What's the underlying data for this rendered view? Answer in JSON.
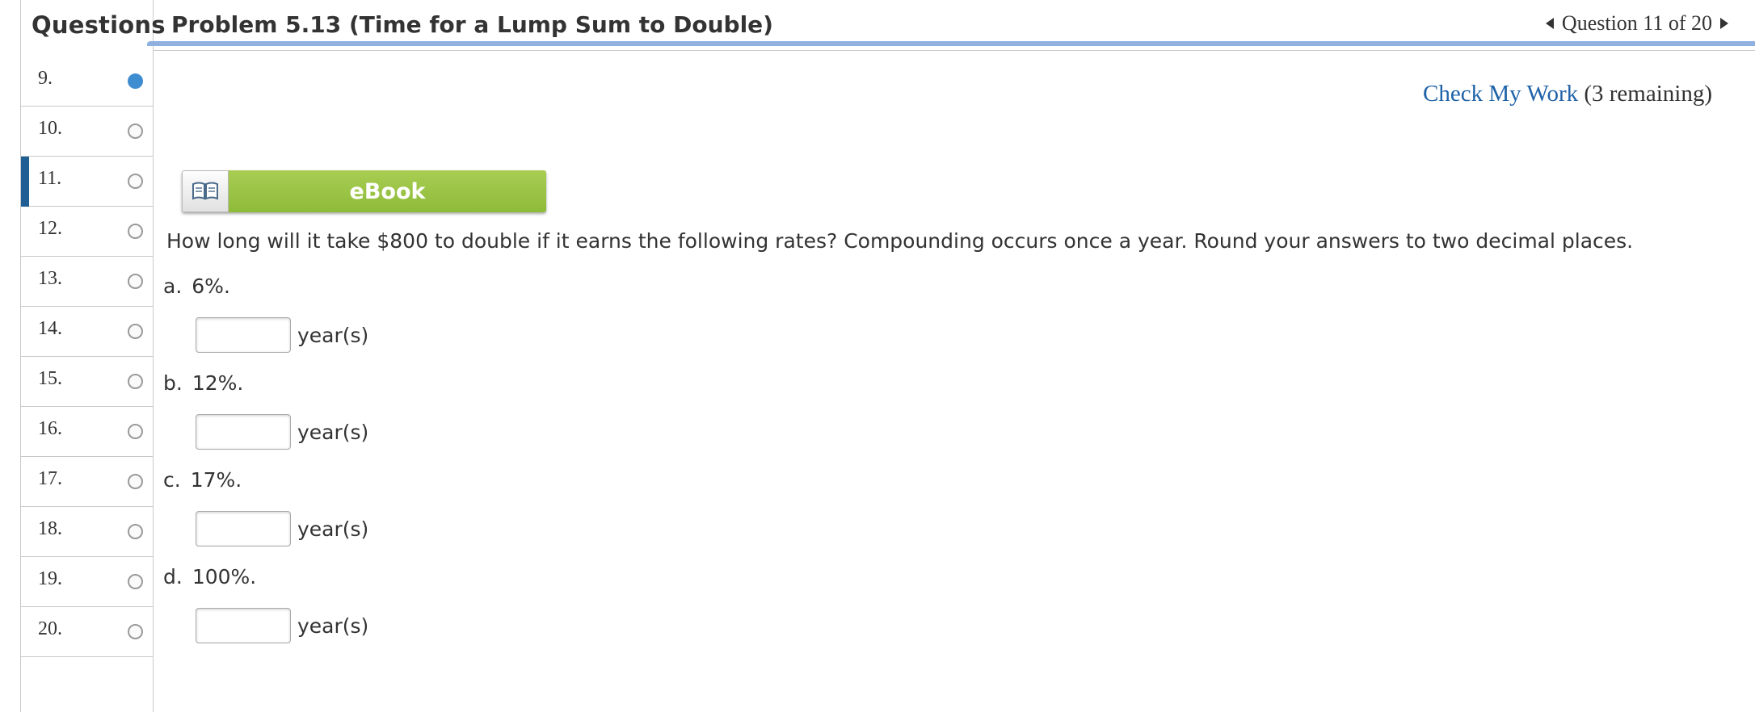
{
  "sidebar": {
    "title": "Questions",
    "items": [
      {
        "num": "9.",
        "state": "answered"
      },
      {
        "num": "10.",
        "state": "unanswered"
      },
      {
        "num": "11.",
        "state": "current"
      },
      {
        "num": "12.",
        "state": "unanswered"
      },
      {
        "num": "13.",
        "state": "unanswered"
      },
      {
        "num": "14.",
        "state": "unanswered"
      },
      {
        "num": "15.",
        "state": "unanswered"
      },
      {
        "num": "16.",
        "state": "unanswered"
      },
      {
        "num": "17.",
        "state": "unanswered"
      },
      {
        "num": "18.",
        "state": "unanswered"
      },
      {
        "num": "19.",
        "state": "unanswered"
      },
      {
        "num": "20.",
        "state": "unanswered"
      }
    ]
  },
  "header": {
    "problem_title": "Problem 5.13 (Time for a Lump Sum to Double)",
    "nav_text": "Question 11 of 20"
  },
  "check": {
    "link": "Check My Work",
    "remaining": "(3 remaining)"
  },
  "ebook": {
    "label": "eBook",
    "icon": "book-icon"
  },
  "question": "How long will it take $800 to double if it earns the following rates? Compounding occurs once a year. Round your answers to two decimal places.",
  "parts": [
    {
      "letter": "a.",
      "rate": "6%.",
      "value": "",
      "unit": "year(s)"
    },
    {
      "letter": "b.",
      "rate": "12%.",
      "value": "",
      "unit": "year(s)"
    },
    {
      "letter": "c.",
      "rate": "17%.",
      "value": "",
      "unit": "year(s)"
    },
    {
      "letter": "d.",
      "rate": "100%.",
      "value": "",
      "unit": "year(s)"
    }
  ],
  "colors": {
    "accent_blue": "#1f5f94",
    "answered_dot": "#3f8dd1",
    "link": "#1f62a8",
    "ebook_green": "#9bc548",
    "header_rule": "#8fb1e0"
  }
}
